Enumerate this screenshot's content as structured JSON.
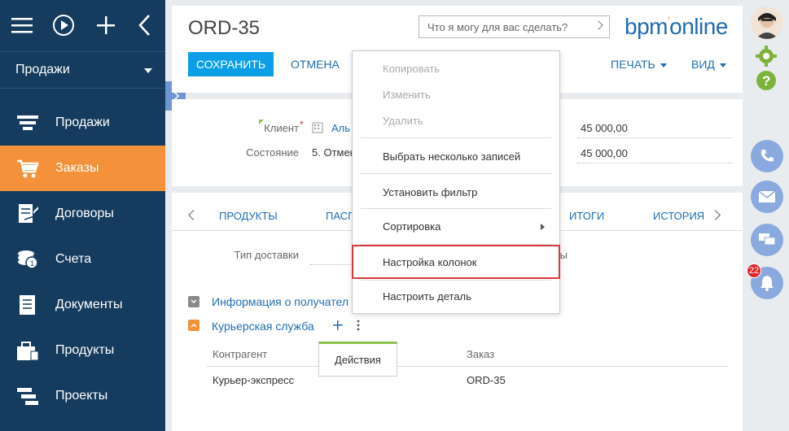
{
  "sidebar": {
    "section": "Продажи",
    "items": [
      {
        "label": "Продажи"
      },
      {
        "label": "Заказы"
      },
      {
        "label": "Договоры"
      },
      {
        "label": "Счета"
      },
      {
        "label": "Документы"
      },
      {
        "label": "Продукты"
      },
      {
        "label": "Проекты"
      }
    ],
    "active_color": "#f4913b",
    "bg_color": "#153c5e"
  },
  "header": {
    "title": "ORD-35",
    "search_placeholder": "Что я могу для вас сделать?",
    "logo": "bpm'online",
    "save_label": "СОХРАНИТЬ",
    "cancel_label": "ОТМЕНА",
    "print_label": "ПЕЧАТЬ",
    "view_label": "ВИД"
  },
  "info": {
    "client_label": "Клиент",
    "client_value": "Аль",
    "state_label": "Состояние",
    "state_value": "5. Отмен",
    "amount1": "45 000,00",
    "amount2": "45 000,00"
  },
  "tabs": {
    "items": [
      "ПРОДУКТЫ",
      "ПАСП",
      "ИТОГИ",
      "ИСТОРИЯ"
    ],
    "delivery_label": "Тип доставки",
    "partial_label": "ы"
  },
  "groups": {
    "recipient": "Информация о получател",
    "courier": "Курьерская служба"
  },
  "table": {
    "columns": [
      "Контрагент",
      "Заказ"
    ],
    "rows": [
      [
        "Курьер-экспресс",
        "ORD-35"
      ]
    ]
  },
  "menu": {
    "items": [
      {
        "label": "Копировать",
        "disabled": true
      },
      {
        "label": "Изменить",
        "disabled": true
      },
      {
        "label": "Удалить",
        "disabled": true
      },
      {
        "label": "Выбрать несколько записей",
        "disabled": false
      },
      {
        "label": "Установить фильтр",
        "disabled": false
      },
      {
        "label": "Сортировка",
        "disabled": false
      },
      {
        "label": "Настройка колонок",
        "disabled": false
      },
      {
        "label": "Настроить деталь",
        "disabled": false
      }
    ]
  },
  "tooltip": "Действия",
  "notifications": {
    "count": "22"
  }
}
